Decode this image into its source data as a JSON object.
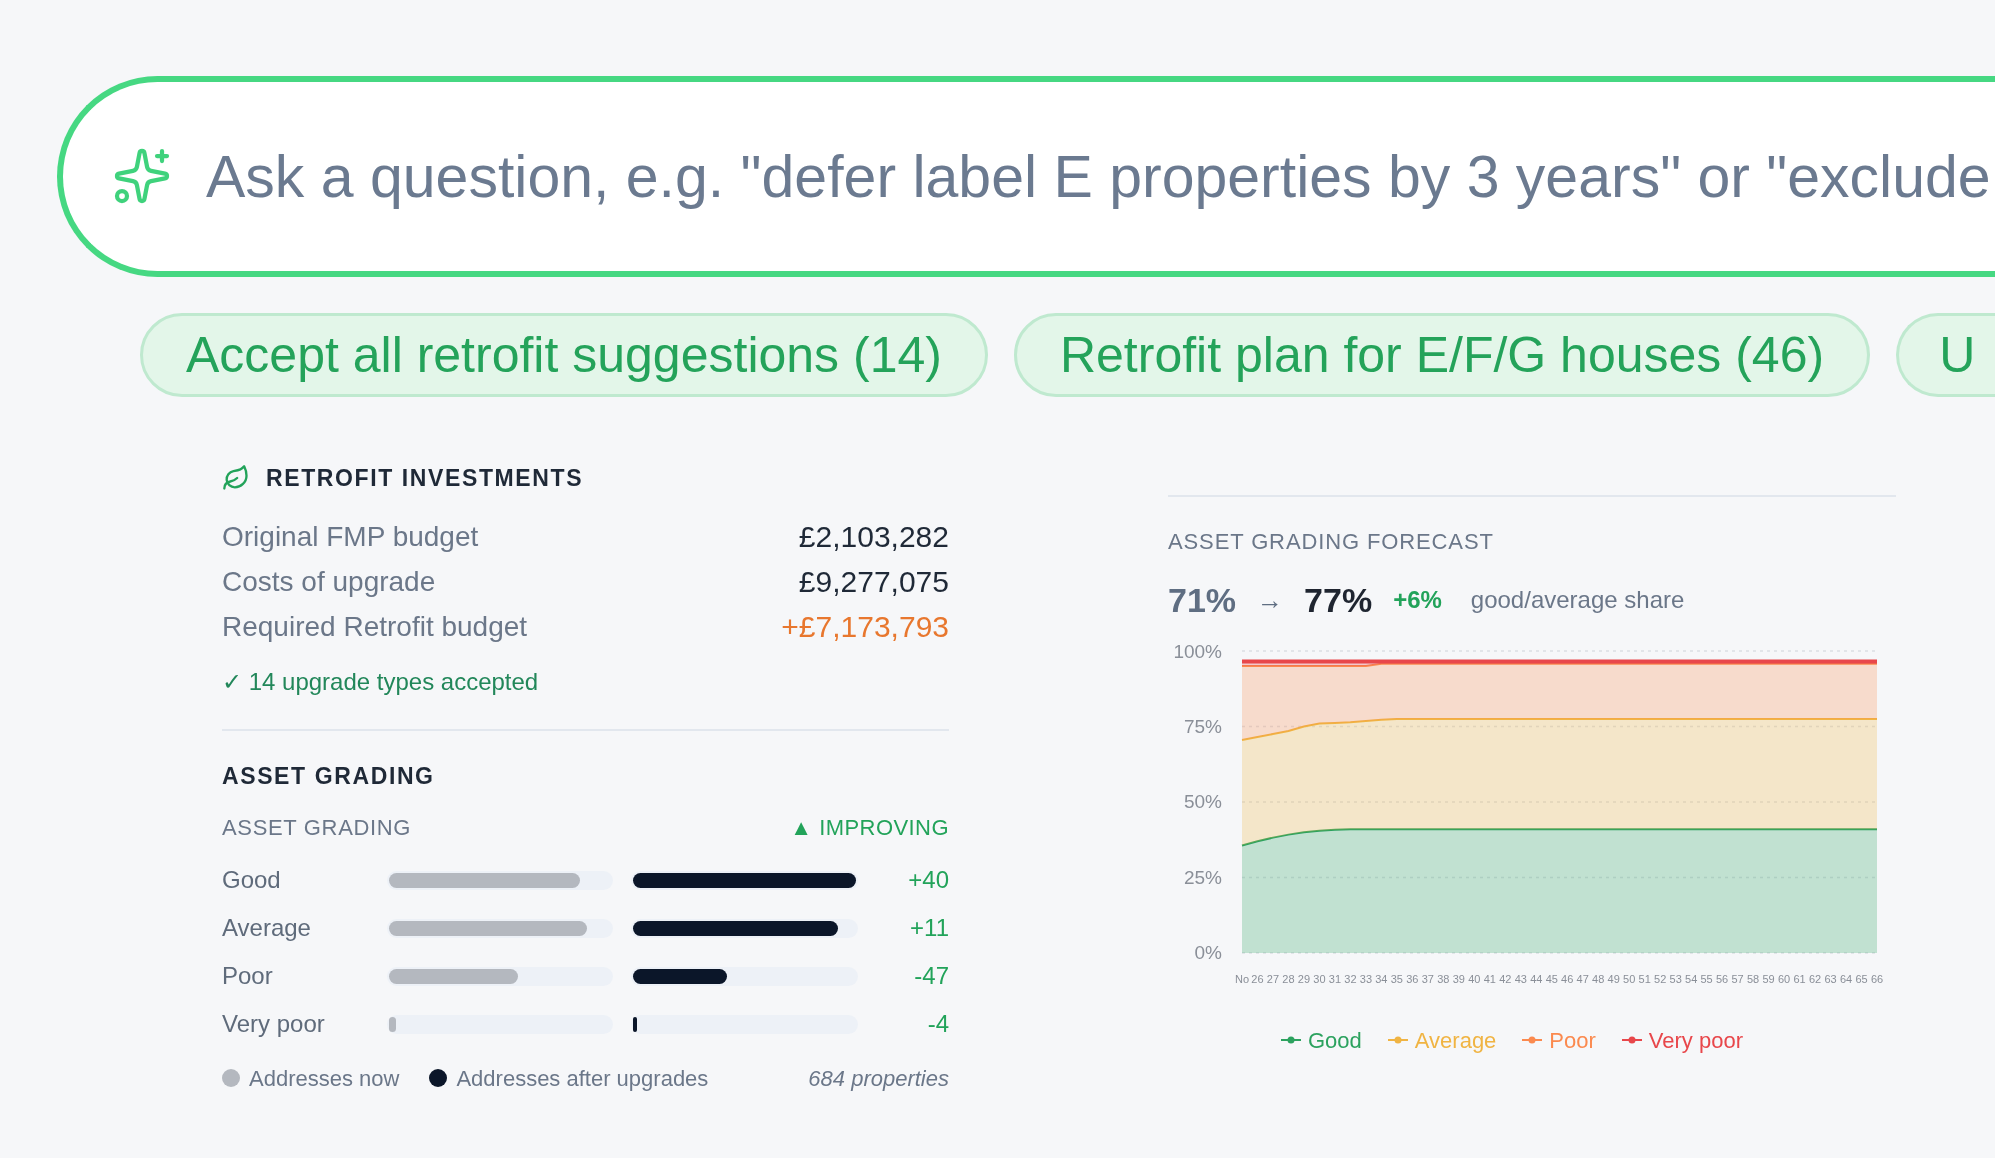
{
  "search": {
    "placeholder": "Ask a question, e.g. \"defer label E properties by 3 years\" or \"exclude"
  },
  "suggestions": [
    {
      "label": "Accept all retrofit suggestions (14)"
    },
    {
      "label": "Retrofit plan for E/F/G houses (46)"
    },
    {
      "label": "U"
    }
  ],
  "retrofit_investments": {
    "title": "RETROFIT INVESTMENTS",
    "rows": [
      {
        "label": "Original FMP budget",
        "value": "£2,103,282",
        "kind": "plain"
      },
      {
        "label": "Costs of upgrade",
        "value": "£9,277,075",
        "kind": "plain"
      },
      {
        "label": "Required Retrofit budget",
        "value": "+£7,173,793",
        "kind": "increase"
      }
    ],
    "note": "✓ 14 upgrade types accepted"
  },
  "asset_grading": {
    "title": "ASSET GRADING",
    "subtitle": "ASSET GRADING",
    "trend": "▲ IMPROVING",
    "rows": [
      {
        "label": "Good",
        "now": {
          "level": 0.86
        },
        "after": {
          "level": 1
        },
        "change": "+40"
      },
      {
        "label": "Average",
        "now": {
          "level": 0.89
        },
        "after": {
          "level": 0.92
        },
        "change": "+11"
      },
      {
        "label": "Poor",
        "now": {
          "level": 0.58
        },
        "after": {
          "level": 0.42
        },
        "change": "-47"
      },
      {
        "label": "Very poor",
        "now": {
          "level": 0.03
        },
        "after": {
          "level": 0.02
        },
        "change": "-4"
      }
    ],
    "legend": [
      {
        "label": "Addresses now",
        "color": "#b4b8bf"
      },
      {
        "label": "Addresses after upgrades",
        "color": "#0b1629"
      }
    ],
    "total": "684 properties"
  },
  "forecast": {
    "title": "ASSET GRADING FORECAST",
    "share_from": "71%",
    "arrow": "→",
    "share_to": "77%",
    "change": "+6%",
    "caption": "good/average share",
    "chart_data": {
      "type": "area",
      "stacked": true,
      "categories": [
        "No",
        "26",
        "27",
        "28",
        "29",
        "30",
        "31",
        "32",
        "33",
        "34",
        "35",
        "36",
        "37",
        "38",
        "39",
        "40",
        "41",
        "42",
        "43",
        "44",
        "45",
        "46",
        "47",
        "48",
        "49",
        "50",
        "51",
        "52",
        "53",
        "54",
        "55",
        "56",
        "57",
        "58",
        "59",
        "60",
        "61",
        "62",
        "63",
        "64",
        "65",
        "66"
      ],
      "ylim": [
        0,
        100
      ],
      "yticks": [
        {
          "value": 0,
          "label": "0%"
        },
        {
          "value": 25,
          "label": "25%"
        },
        {
          "value": 50,
          "label": "50%"
        },
        {
          "value": 75,
          "label": "75%"
        },
        {
          "value": 100,
          "label": "100%"
        }
      ],
      "grid": true,
      "legend": "bottom",
      "series": [
        {
          "name": "Good",
          "color": "#2ca25f",
          "values": [
            35.6,
            37,
            38.2,
            39.2,
            40,
            40.5,
            40.8,
            41,
            41,
            41,
            41,
            41,
            41,
            41,
            41,
            41,
            41,
            41,
            41,
            41,
            41,
            41,
            41,
            41,
            41,
            41,
            41,
            41,
            41,
            41,
            41,
            41,
            41,
            41,
            41,
            41,
            41,
            41,
            41,
            41,
            41,
            41
          ]
        },
        {
          "name": "Average",
          "color": "#f0b443",
          "values": [
            34.9,
            34.5,
            34.3,
            34.3,
            35,
            35.5,
            35.4,
            35.4,
            35.8,
            36.2,
            36.5,
            36.5,
            36.5,
            36.5,
            36.5,
            36.5,
            36.5,
            36.5,
            36.5,
            36.5,
            36.5,
            36.5,
            36.5,
            36.5,
            36.5,
            36.5,
            36.5,
            36.5,
            36.5,
            36.5,
            36.5,
            36.5,
            36.5,
            36.5,
            36.5,
            36.5,
            36.5,
            36.5,
            36.5,
            36.5,
            36.5,
            36.5
          ]
        },
        {
          "name": "Poor",
          "color": "#fb8a4f",
          "values": [
            24.5,
            23.5,
            22.5,
            21.5,
            20,
            19,
            18.8,
            18.6,
            18.2,
            18.6,
            18.3,
            18.3,
            18.3,
            18.3,
            18.3,
            18.3,
            18.3,
            18.3,
            18.3,
            18.3,
            18.3,
            18.3,
            18.3,
            18.3,
            18.3,
            18.3,
            18.3,
            18.3,
            18.3,
            18.3,
            18.3,
            18.3,
            18.3,
            18.3,
            18.3,
            18.3,
            18.3,
            18.3,
            18.3,
            18.3,
            18.3,
            18.3
          ]
        },
        {
          "name": "Very poor",
          "color": "#e8474b",
          "values": [
            1.5,
            1.5,
            1.5,
            1.5,
            1.5,
            1.5,
            1.5,
            1.5,
            1.5,
            0.7,
            0.7,
            0.7,
            0.7,
            0.7,
            0.7,
            0.7,
            0.7,
            0.7,
            0.7,
            0.7,
            0.7,
            0.7,
            0.7,
            0.7,
            0.7,
            0.7,
            0.7,
            0.7,
            0.7,
            0.7,
            0.7,
            0.7,
            0.7,
            0.7,
            0.7,
            0.7,
            0.7,
            0.7,
            0.7,
            0.7,
            0.7,
            0.7
          ]
        }
      ]
    }
  }
}
